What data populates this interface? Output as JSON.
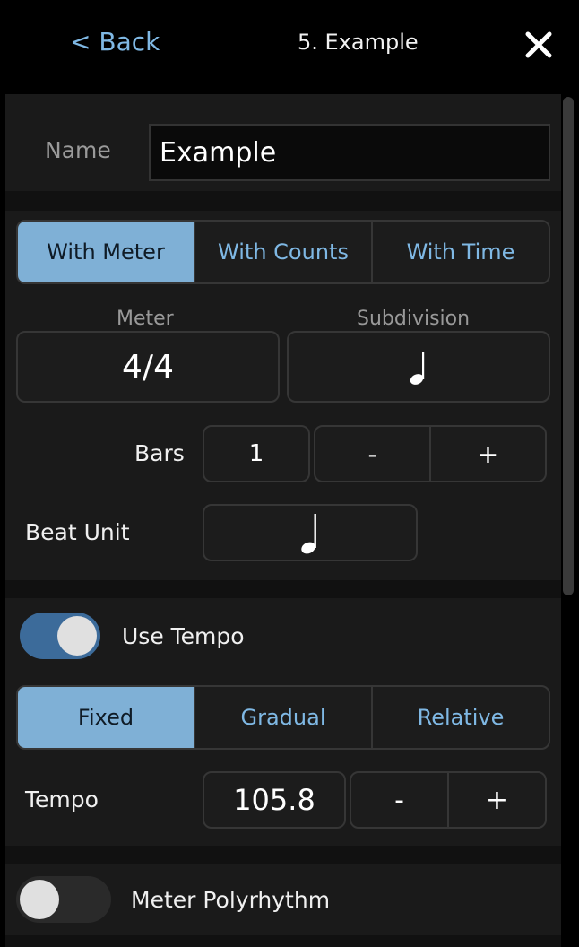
{
  "header": {
    "back_label": "< Back",
    "title": "5. Example",
    "close_icon": "close-icon"
  },
  "name_field": {
    "label": "Name",
    "value": "Example"
  },
  "mode_tabs": {
    "items": [
      "With Meter",
      "With Counts",
      "With Time"
    ],
    "selected": "With Meter"
  },
  "meter": {
    "meter_label": "Meter",
    "meter_value": "4/4",
    "subdivision_label": "Subdivision",
    "subdivision_icon": "quarter-note-icon",
    "bars_label": "Bars",
    "bars_value": "1",
    "minus_label": "-",
    "plus_label": "+",
    "beat_unit_label": "Beat Unit",
    "beat_unit_icon": "half-note-icon"
  },
  "tempo": {
    "use_tempo_label": "Use Tempo",
    "use_tempo_on": true,
    "type_tabs": [
      "Fixed",
      "Gradual",
      "Relative"
    ],
    "type_selected": "Fixed",
    "tempo_label": "Tempo",
    "tempo_value": "105.8",
    "minus_label": "-",
    "plus_label": "+"
  },
  "polyrhythm": {
    "label": "Meter Polyrhythm",
    "on": false
  },
  "colors": {
    "accent": "#7fb8e4",
    "selected_segment": "#7fb0d6",
    "toggle_on": "#3c6b9a"
  }
}
